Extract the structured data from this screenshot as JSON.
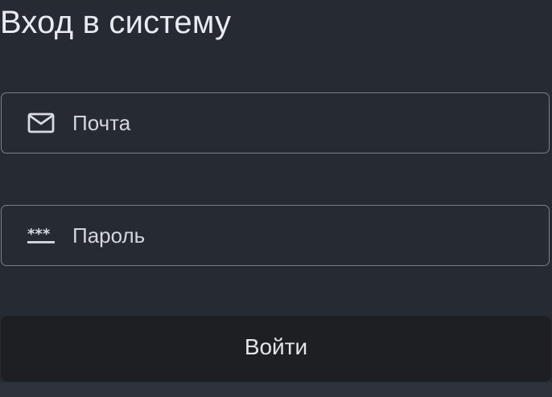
{
  "login_form": {
    "title": "Вход в систему",
    "email": {
      "placeholder": "Почта",
      "value": "",
      "icon": "mail-icon"
    },
    "password": {
      "placeholder": "Пароль",
      "value": "",
      "icon": "password-dots-icon"
    },
    "submit_label": "Войти"
  },
  "colors": {
    "background": "#262a33",
    "field_border": "#7b7f87",
    "button_background": "#1e1f23",
    "text": "#e6e8ee"
  }
}
